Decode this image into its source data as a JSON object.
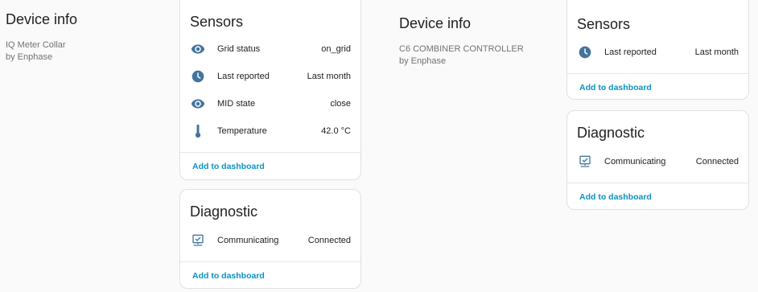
{
  "left": {
    "device_info": {
      "title": "Device info",
      "model": "IQ Meter Collar",
      "manufacturer": "by Enphase"
    },
    "sensors": {
      "title": "Sensors",
      "rows": [
        {
          "icon": "eye-icon",
          "label": "Grid status",
          "value": "on_grid"
        },
        {
          "icon": "clock-icon",
          "label": "Last reported",
          "value": "Last month"
        },
        {
          "icon": "eye-icon",
          "label": "MID state",
          "value": "close"
        },
        {
          "icon": "thermometer-icon",
          "label": "Temperature",
          "value": "42.0 °C"
        }
      ],
      "action": "Add to dashboard"
    },
    "diagnostic": {
      "title": "Diagnostic",
      "rows": [
        {
          "icon": "network-check-icon",
          "label": "Communicating",
          "value": "Connected"
        }
      ],
      "action": "Add to dashboard"
    }
  },
  "right": {
    "device_info": {
      "title": "Device info",
      "model": "C6 COMBINER CONTROLLER",
      "manufacturer": "by Enphase"
    },
    "sensors": {
      "title": "Sensors",
      "rows": [
        {
          "icon": "clock-icon",
          "label": "Last reported",
          "value": "Last month"
        }
      ],
      "action": "Add to dashboard"
    },
    "diagnostic": {
      "title": "Diagnostic",
      "rows": [
        {
          "icon": "network-check-icon",
          "label": "Communicating",
          "value": "Connected"
        }
      ],
      "action": "Add to dashboard"
    }
  },
  "colors": {
    "icon": "#44739e",
    "link": "#0a93c4",
    "border": "#e0e0e0"
  }
}
